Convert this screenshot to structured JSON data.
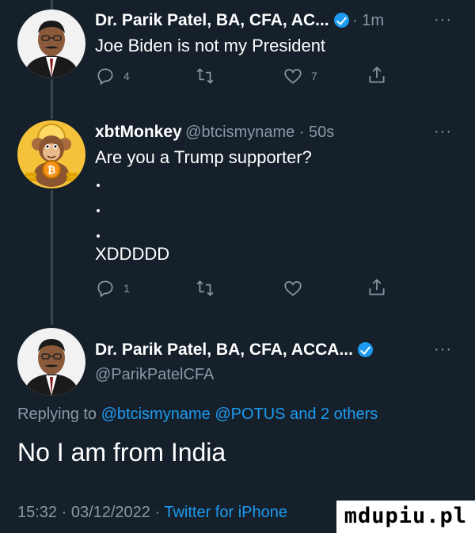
{
  "tweet1": {
    "author": "Dr. Parik Patel, BA, CFA, AC...",
    "time": "· 1m",
    "more": "···",
    "text": "Joe Biden is not my President",
    "actions": {
      "reply_count": "4",
      "retweet_count": "",
      "like_count": "7"
    }
  },
  "tweet2": {
    "author": "xbtMonkey",
    "handle_time": "@btcismyname · 50s",
    "more": "···",
    "text": "Are you a Trump supporter?",
    "text_last": "XDDDDD",
    "actions": {
      "reply_count": "1",
      "retweet_count": "",
      "like_count": ""
    }
  },
  "main_tweet": {
    "author": "Dr. Parik Patel, BA, CFA, ACCA...",
    "handle": "@ParikPatelCFA",
    "more": "···",
    "replying_prefix": "Replying to",
    "replying_user1": "@btcismyname",
    "replying_user2": "@POTUS",
    "replying_suffix": "and 2 others",
    "text": "No I am from India",
    "timestamp": "15:32 · 03/12/2022 ·",
    "source": "Twitter for iPhone"
  },
  "watermark": "mdupiu.pl",
  "colors": {
    "background": "#15202b",
    "muted": "#8899a6",
    "accent": "#1d9bf0",
    "thread": "#38444d"
  },
  "icons": [
    "reply-icon",
    "retweet-icon",
    "like-icon",
    "share-icon",
    "verified-badge-icon",
    "more-icon"
  ]
}
